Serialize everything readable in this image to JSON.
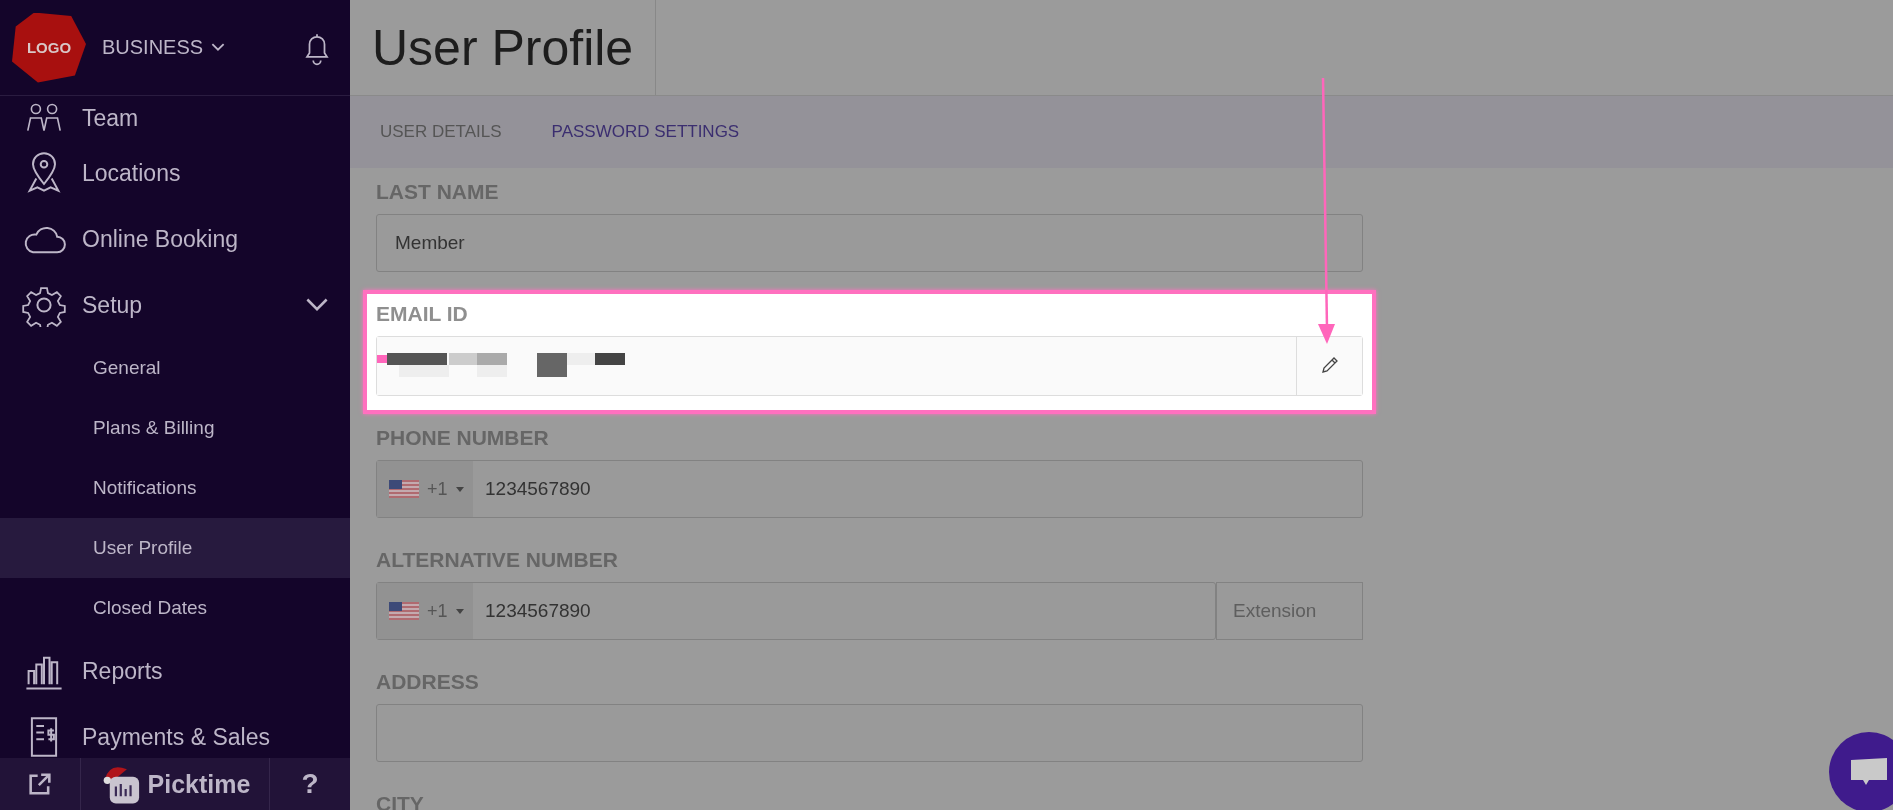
{
  "header": {
    "logo": "LOGO",
    "business": "BUSINESS"
  },
  "sidebar": {
    "items": [
      {
        "label": "Team",
        "selected": false
      },
      {
        "label": "Locations",
        "selected": false
      },
      {
        "label": "Online Booking",
        "selected": false
      },
      {
        "label": "Setup",
        "selected": false,
        "expanded": true,
        "children": [
          {
            "label": "General",
            "selected": false
          },
          {
            "label": "Plans & Billing",
            "selected": false
          },
          {
            "label": "Notifications",
            "selected": false
          },
          {
            "label": "User Profile",
            "selected": true
          },
          {
            "label": "Closed Dates",
            "selected": false
          }
        ]
      },
      {
        "label": "Reports",
        "selected": false
      },
      {
        "label": "Payments & Sales",
        "selected": false
      }
    ]
  },
  "footer": {
    "brand": "Picktime",
    "help": "?"
  },
  "page": {
    "title": "User Profile"
  },
  "tabs": [
    {
      "label": "USER DETAILS",
      "selected": false
    },
    {
      "label": "PASSWORD SETTINGS",
      "selected": true
    }
  ],
  "form": {
    "fields": [
      {
        "kind": "text",
        "label": "LAST NAME",
        "value": "Member",
        "highlighted": false
      },
      {
        "kind": "email",
        "label": "EMAIL ID",
        "highlighted": true
      },
      {
        "kind": "phone",
        "label": "PHONE NUMBER",
        "code": "+1",
        "value": "1234567890",
        "highlighted": false
      },
      {
        "kind": "phone",
        "label": "ALTERNATIVE NUMBER",
        "code": "+1",
        "value": "1234567890",
        "extension_placeholder": "Extension",
        "highlighted": false
      },
      {
        "kind": "text",
        "label": "ADDRESS",
        "highlighted": false
      },
      {
        "kind": "label",
        "label": "CITY",
        "highlighted": false
      }
    ]
  }
}
